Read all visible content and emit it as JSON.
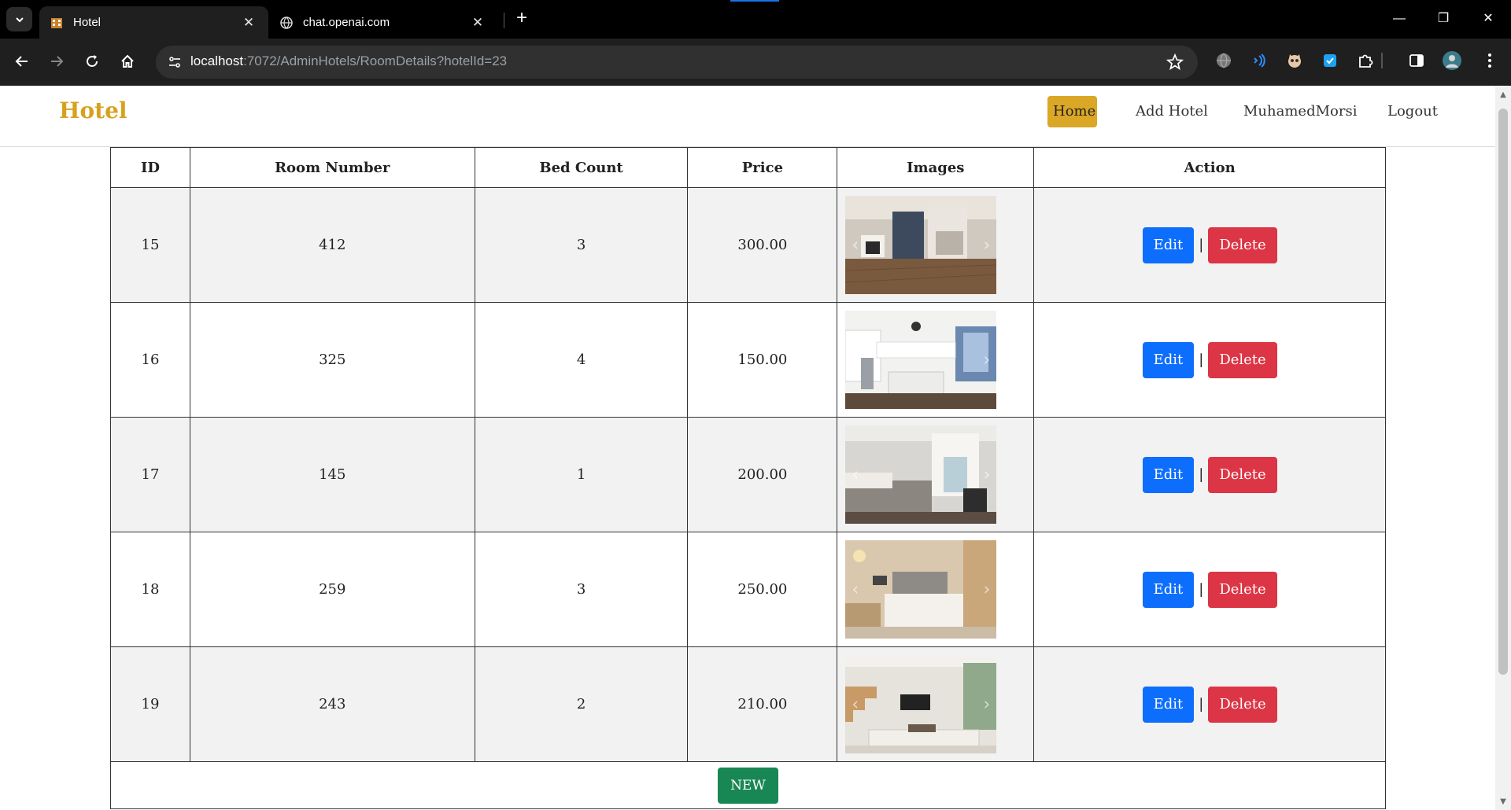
{
  "browser": {
    "tabs": [
      {
        "title": "Hotel",
        "active": true
      },
      {
        "title": "chat.openai.com",
        "active": false
      }
    ],
    "new_tab_label": "+",
    "url_host": "localhost",
    "url_rest": ":7072/AdminHotels/RoomDetails?hotelId=23",
    "window_controls": {
      "minimize": "—",
      "restore": "❐",
      "close": "✕"
    }
  },
  "navbar": {
    "brand": "Hotel",
    "links": {
      "home": "Home",
      "add_hotel": "Add Hotel",
      "user": "MuhamedMorsi",
      "logout": "Logout"
    },
    "accent_color": "#dba726"
  },
  "table": {
    "headers": {
      "id": "ID",
      "room_number": "Room Number",
      "bed_count": "Bed Count",
      "price": "Price",
      "images": "Images",
      "action": "Action"
    },
    "rows": [
      {
        "id": "15",
        "room_number": "412",
        "bed_count": "3",
        "price": "300.00",
        "image": "living-room-photo"
      },
      {
        "id": "16",
        "room_number": "325",
        "bed_count": "4",
        "price": "150.00",
        "image": "kitchen-photo"
      },
      {
        "id": "17",
        "room_number": "145",
        "bed_count": "1",
        "price": "200.00",
        "image": "bedroom-photo"
      },
      {
        "id": "18",
        "room_number": "259",
        "bed_count": "3",
        "price": "250.00",
        "image": "hotel-room-photo"
      },
      {
        "id": "19",
        "room_number": "243",
        "bed_count": "2",
        "price": "210.00",
        "image": "lounge-photo"
      }
    ],
    "edit_label": "Edit",
    "delete_label": "Delete",
    "separator": "|",
    "new_label": "NEW"
  },
  "colors": {
    "edit": "#0d6efd",
    "delete": "#dc3545",
    "new": "#198754"
  }
}
